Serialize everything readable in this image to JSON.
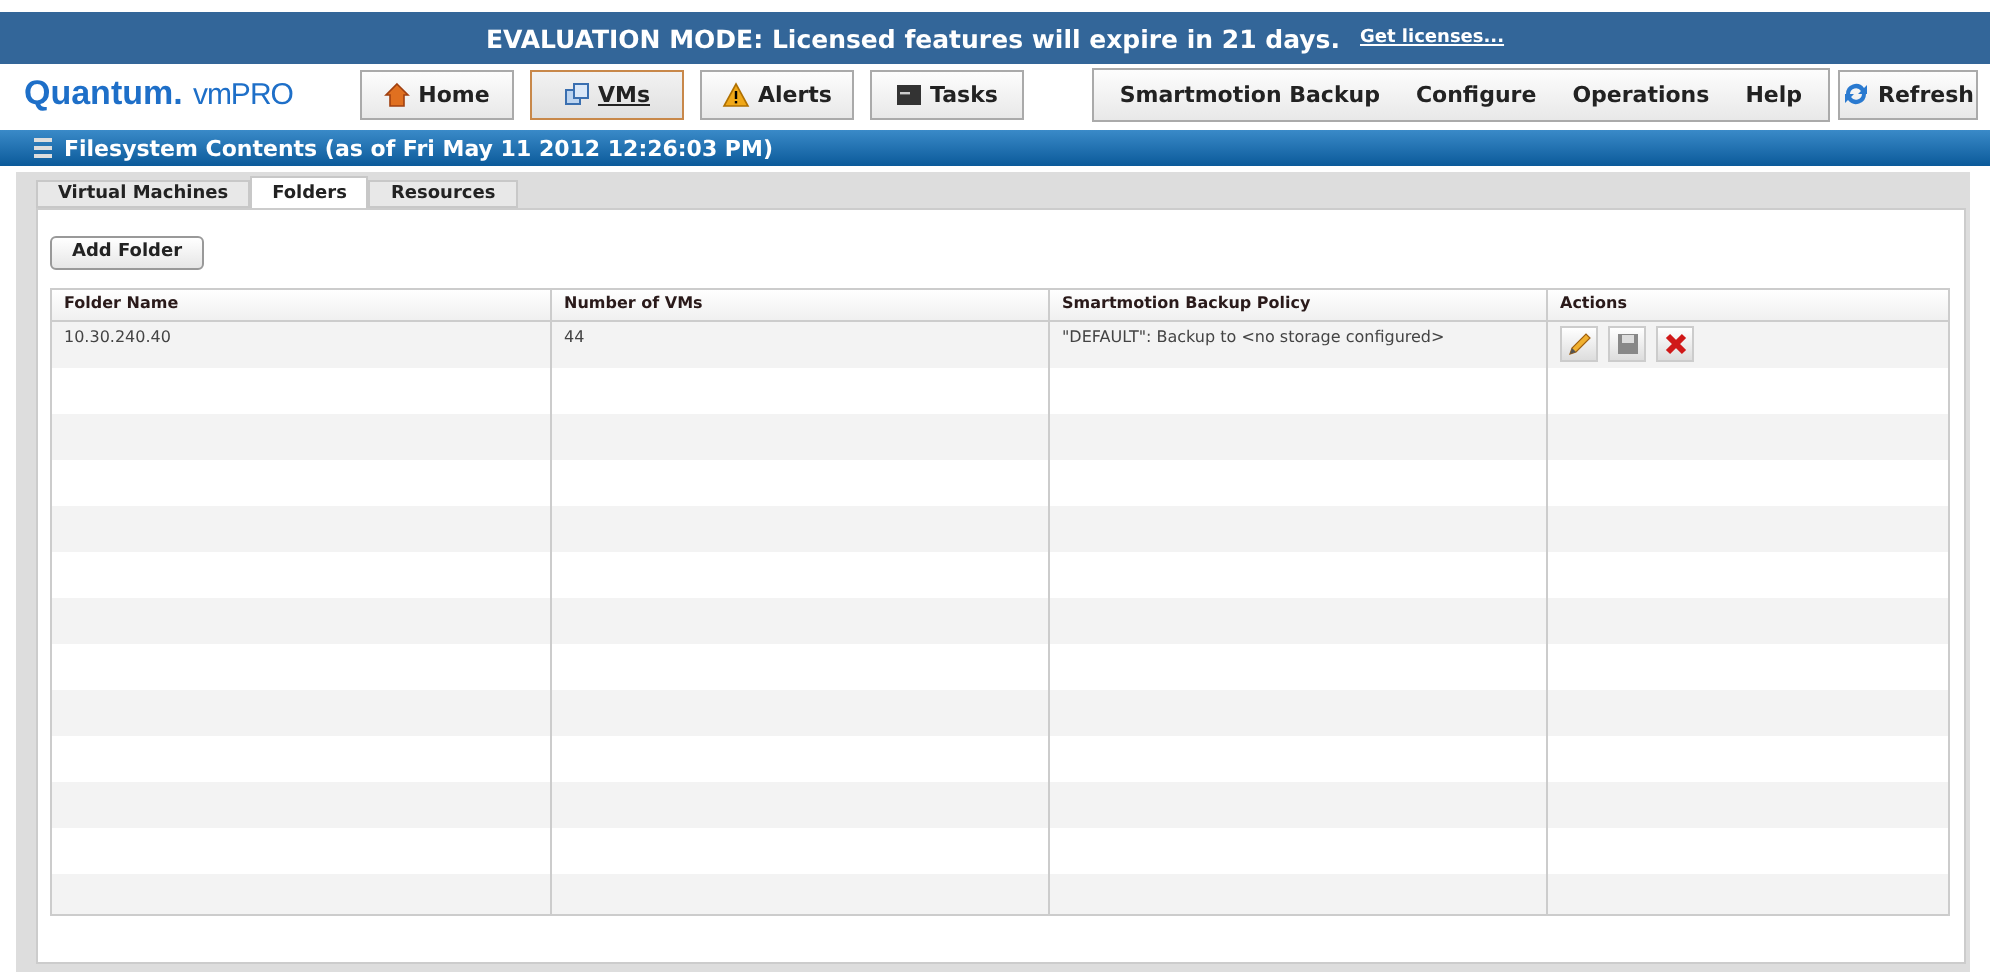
{
  "banner": {
    "message": "EVALUATION MODE: Licensed features will expire in 21 days.",
    "link": "Get licenses..."
  },
  "logo": {
    "brand": "Quantum.",
    "product": "vmPRO"
  },
  "nav_buttons": [
    {
      "label": "Home",
      "kind": "home",
      "selected": false
    },
    {
      "label": "VMs",
      "kind": "vms",
      "selected": true
    },
    {
      "label": "Alerts",
      "kind": "alert",
      "selected": false
    },
    {
      "label": "Tasks",
      "kind": "tasks",
      "selected": false
    }
  ],
  "menu": [
    "Smartmotion Backup",
    "Configure",
    "Operations",
    "Help"
  ],
  "refresh_button": "Refresh",
  "section_title": "Filesystem Contents (as of Fri May 11 2012 12:26:03 PM)",
  "tabs": [
    {
      "label": "Virtual Machines",
      "selected": false
    },
    {
      "label": "Folders",
      "selected": true
    },
    {
      "label": "Resources",
      "selected": false
    }
  ],
  "add_button": "Add Folder",
  "table": {
    "columns": [
      "Folder Name",
      "Number of VMs",
      "Smartmotion Backup Policy",
      "Actions"
    ],
    "rows": [
      {
        "folder": "10.30.240.40",
        "vms": "44",
        "policy": "\"DEFAULT\": Backup  to <no storage configured>"
      }
    ]
  }
}
